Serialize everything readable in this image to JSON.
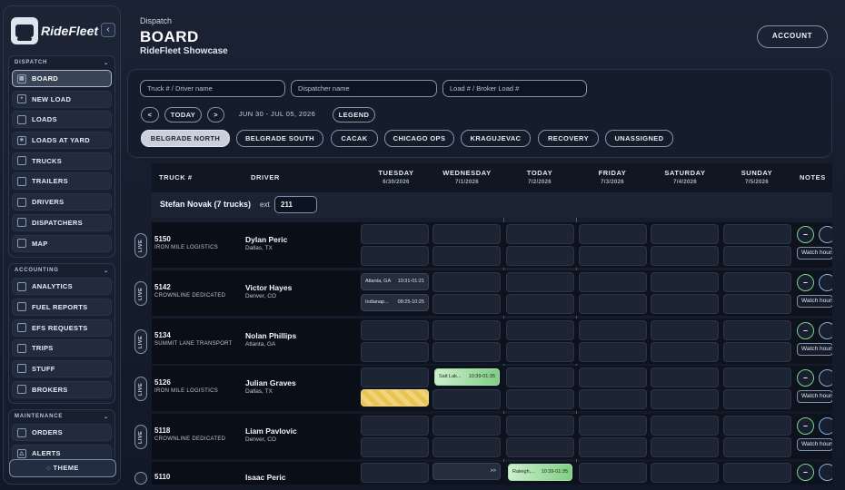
{
  "brand": {
    "name": "RideFleet"
  },
  "sidebar": {
    "collapse_icon": "chevron-left-icon",
    "dispatch": {
      "title": "DISPATCH",
      "items": [
        {
          "label": "BOARD",
          "icon": "grid-icon",
          "active": true
        },
        {
          "label": "NEW LOAD",
          "icon": "plus-icon"
        },
        {
          "label": "LOADS",
          "icon": "box-icon"
        },
        {
          "label": "LOADS AT YARD",
          "icon": "yard-icon"
        },
        {
          "label": "TRUCKS",
          "icon": "truck-icon"
        },
        {
          "label": "TRAILERS",
          "icon": "trailer-icon"
        },
        {
          "label": "DRIVERS",
          "icon": "driver-icon"
        },
        {
          "label": "DISPATCHERS",
          "icon": "dispatcher-icon"
        },
        {
          "label": "MAP",
          "icon": "map-icon"
        }
      ]
    },
    "accounting": {
      "title": "ACCOUNTING",
      "items": [
        {
          "label": "ANALYTICS",
          "icon": "analytics-icon"
        },
        {
          "label": "FUEL REPORTS",
          "icon": "fuel-icon"
        },
        {
          "label": "EFS REQUESTS",
          "icon": "efs-icon"
        },
        {
          "label": "TRIPS",
          "icon": "trips-icon"
        },
        {
          "label": "STUFF",
          "icon": "stuff-icon"
        },
        {
          "label": "BROKERS",
          "icon": "brokers-icon"
        }
      ]
    },
    "maintenance": {
      "title": "MAINTENANCE",
      "items": [
        {
          "label": "ORDERS",
          "icon": "orders-icon"
        },
        {
          "label": "ALERTS",
          "icon": "alert-icon"
        }
      ]
    },
    "theme_label": "THEME"
  },
  "header": {
    "section": "Dispatch",
    "title": "BOARD",
    "subtitle": "RideFleet Showcase",
    "account_label": "ACCOUNT"
  },
  "filters": {
    "truck_placeholder": "Truck # / Driver name",
    "dispatcher_placeholder": "Dispatcher name",
    "load_placeholder": "Load # / Broker Load #",
    "prev": "<",
    "today": "TODAY",
    "next": ">",
    "date_range": "JUN 30 - JUL 05, 2026",
    "legend": "LEGEND",
    "groups": [
      "BELGRADE NORTH",
      "BELGRADE SOUTH",
      "CACAK",
      "CHICAGO OPS",
      "KRAGUJEVAC",
      "RECOVERY",
      "UNASSIGNED"
    ],
    "selected_group": "BELGRADE NORTH"
  },
  "board": {
    "columns": {
      "truck": "TRUCK #",
      "driver": "DRIVER",
      "notes": "NOTES",
      "days": [
        {
          "name": "TUESDAY",
          "date": "6/30/2026"
        },
        {
          "name": "WEDNESDAY",
          "date": "7/1/2026"
        },
        {
          "name": "TODAY",
          "date": "7/2/2026"
        },
        {
          "name": "FRIDAY",
          "date": "7/3/2026"
        },
        {
          "name": "SATURDAY",
          "date": "7/4/2026"
        },
        {
          "name": "SUNDAY",
          "date": "7/5/2026"
        }
      ]
    },
    "group": {
      "label": "Stefan Novak (7 trucks)",
      "ext_label": "ext",
      "ext_value": "211"
    },
    "live_label": "LIVE",
    "watch_label": "Watch hours",
    "minus_label": "–",
    "rows": [
      {
        "truck": "5150",
        "carrier": "IRON MILE LOGISTICS",
        "driver": "Dylan Peric",
        "location": "Dallas, TX"
      },
      {
        "truck": "5142",
        "carrier": "CROWNLINE DEDICATED",
        "driver": "Victor Hayes",
        "location": "Denver, CO"
      },
      {
        "truck": "5134",
        "carrier": "SUMMIT LANE TRANSPORT",
        "driver": "Nolan Phillips",
        "location": "Atlanta, GA"
      },
      {
        "truck": "5126",
        "carrier": "IRON MILE LOGISTICS",
        "driver": "Julian Graves",
        "location": "Dallas, TX"
      },
      {
        "truck": "5118",
        "carrier": "CROWNLINE DEDICATED",
        "driver": "Liam Pavlovic",
        "location": "Denver, CO"
      },
      {
        "truck": "5110",
        "carrier": "",
        "driver": "Isaac Peric",
        "location": ""
      }
    ],
    "loads": {
      "r1_tue_a": {
        "city": "Atlanta, GA",
        "time": "10:31-01:21"
      },
      "r1_tue_b": {
        "city": "Indianap...",
        "time": "08:25-10:25"
      },
      "r3_wed": {
        "city": "Salt Lak...",
        "time": "10:39-01:35"
      },
      "r5_wed": {
        "city": "",
        "time": ">>"
      },
      "r5_today": {
        "city": "Raleigh,...",
        "time": "10:39-01:35"
      }
    }
  }
}
